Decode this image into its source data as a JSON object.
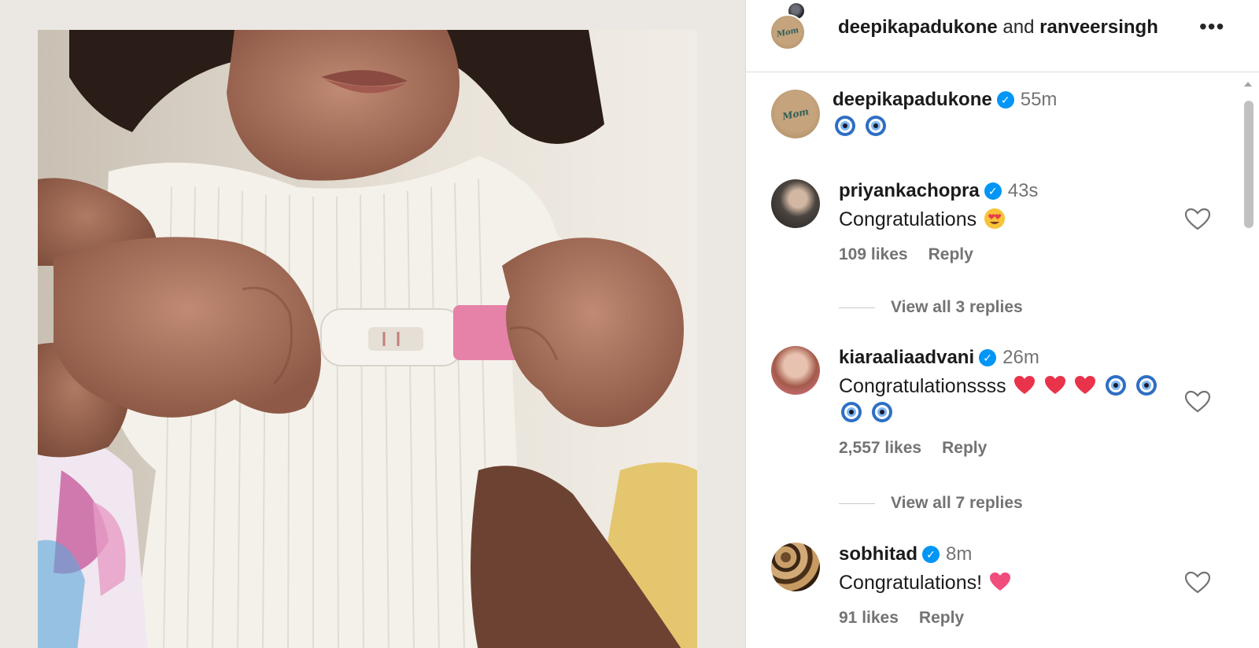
{
  "header": {
    "user1": "deepikapadukone",
    "and_text": "and",
    "user2": "ranveersingh",
    "more_label": "•••",
    "avatar_text": "Mom"
  },
  "comments": [
    {
      "username": "deepikapadukone",
      "verified": true,
      "time": "55m",
      "text": "",
      "emojis": [
        "nazar-amulet",
        "nazar-amulet"
      ],
      "avatar_text": "Mom"
    },
    {
      "username": "priyankachopra",
      "verified": true,
      "time": "43s",
      "text": "Congratulations",
      "emojis": [
        "heart-eyes"
      ],
      "likes": "109 likes",
      "reply": "Reply",
      "view_replies": "View all 3 replies"
    },
    {
      "username": "kiaraaliaadvani",
      "verified": true,
      "time": "26m",
      "text": "Congratulationssss",
      "emojis": [
        "red-heart",
        "red-heart",
        "red-heart",
        "nazar-amulet",
        "nazar-amulet",
        "nazar-amulet",
        "nazar-amulet"
      ],
      "likes": "2,557 likes",
      "reply": "Reply",
      "view_replies": "View all 7 replies"
    },
    {
      "username": "sobhitad",
      "verified": true,
      "time": "8m",
      "text": "Congratulations!",
      "emojis": [
        "pink-heart"
      ],
      "likes": "91 likes",
      "reply": "Reply"
    }
  ],
  "colors": {
    "verified": "#0095f6",
    "meta_text": "#737373",
    "divider": "#dbdbdb"
  }
}
